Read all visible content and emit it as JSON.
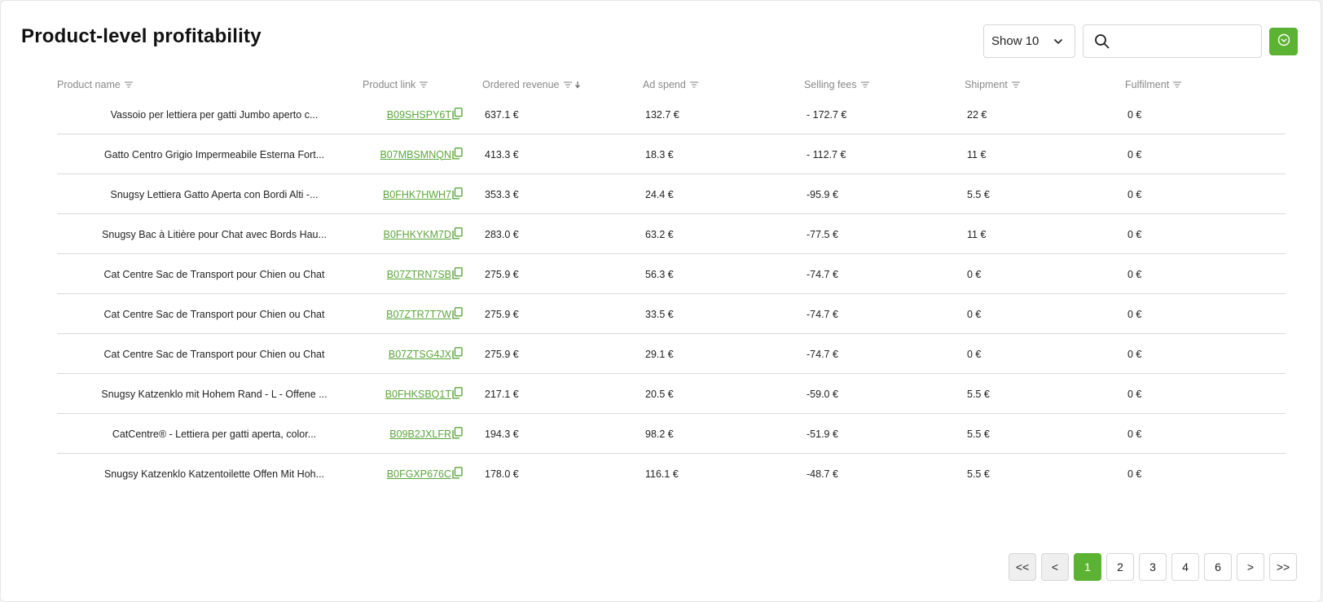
{
  "title": "Product-level profitability",
  "page_size": {
    "selected": "Show 10"
  },
  "search": {
    "placeholder": ""
  },
  "columns": {
    "product_name": "Product name",
    "product_link": "Product link",
    "ordered_revenue": "Ordered revenue",
    "ad_spend": "Ad spend",
    "selling_fees": "Selling fees",
    "shipment": "Shipment",
    "fulfilment": "Fulfilment"
  },
  "rows": [
    {
      "name": "Vassoio per lettiera per gatti Jumbo aperto c...",
      "link": "B09SHSPY6T",
      "revenue": "637.1 €",
      "ad": "132.7 €",
      "fees": "- 172.7 €",
      "ship": "22 €",
      "fulfil": "0 €"
    },
    {
      "name": "Gatto Centro Grigio Impermeabile Esterna Fort...",
      "link": "B07MBSMNQN",
      "revenue": "413.3 €",
      "ad": "18.3 €",
      "fees": "- 112.7 €",
      "ship": "11 €",
      "fulfil": "0 €"
    },
    {
      "name": "Snugsy Lettiera Gatto Aperta con Bordi Alti -...",
      "link": "B0FHK7HWH7",
      "revenue": "353.3 €",
      "ad": "24.4 €",
      "fees": "-95.9 €",
      "ship": "5.5 €",
      "fulfil": "0 €"
    },
    {
      "name": "Snugsy Bac à Litière pour Chat avec Bords Hau...",
      "link": "B0FHKYKM7D",
      "revenue": "283.0 €",
      "ad": "63.2 €",
      "fees": "-77.5 €",
      "ship": "11 €",
      "fulfil": "0 €"
    },
    {
      "name": "Cat Centre Sac de Transport pour Chien ou Chat",
      "link": "B07ZTRN7SB",
      "revenue": "275.9 €",
      "ad": "56.3 €",
      "fees": "-74.7 €",
      "ship": "0 €",
      "fulfil": "0 €"
    },
    {
      "name": "Cat Centre Sac de Transport pour Chien ou Chat",
      "link": "B07ZTR7T7W",
      "revenue": "275.9 €",
      "ad": "33.5 €",
      "fees": "-74.7 €",
      "ship": "0 €",
      "fulfil": "0 €"
    },
    {
      "name": "Cat Centre Sac de Transport pour Chien ou Chat",
      "link": "B07ZTSG4JX",
      "revenue": "275.9 €",
      "ad": "29.1 €",
      "fees": "-74.7 €",
      "ship": "0 €",
      "fulfil": "0 €"
    },
    {
      "name": "Snugsy Katzenklo mit Hohem Rand - L - Offene ...",
      "link": "B0FHKSBQ1T",
      "revenue": "217.1 €",
      "ad": "20.5 €",
      "fees": "-59.0 €",
      "ship": "5.5 €",
      "fulfil": "0 €"
    },
    {
      "name": "CatCentre® - Lettiera per gatti aperta, color...",
      "link": "B09B2JXLFR",
      "revenue": "194.3 €",
      "ad": "98.2 €",
      "fees": "-51.9 €",
      "ship": "5.5 €",
      "fulfil": "0 €"
    },
    {
      "name": "Snugsy Katzenklo Katzentoilette Offen Mit Hoh...",
      "link": "B0FGXP676C",
      "revenue": "178.0 €",
      "ad": "116.1 €",
      "fees": "-48.7 €",
      "ship": "5.5 €",
      "fulfil": "0 €"
    }
  ],
  "pagination": {
    "first": "<<",
    "prev": "<",
    "next": ">",
    "last": ">>",
    "pages": [
      "1",
      "2",
      "3",
      "4",
      "6"
    ],
    "current": "1"
  },
  "colors": {
    "accent": "#5cb233",
    "link": "#5aa63a"
  },
  "icons": [
    "chevron-down-icon",
    "search-icon",
    "circle-chevron-down-icon",
    "filter-icon",
    "sort-desc-icon",
    "copy-icon"
  ]
}
